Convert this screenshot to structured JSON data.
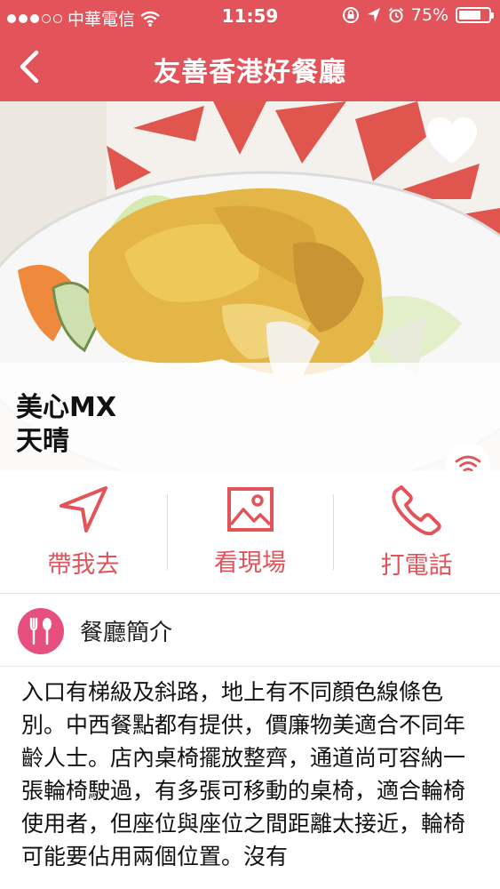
{
  "status_bar": {
    "carrier": "中華電信",
    "time": "11:59",
    "battery": "75%",
    "battery_level": 0.75
  },
  "nav": {
    "title": "友善香港好餐廳"
  },
  "restaurant": {
    "name_line1": "美心MX",
    "name_line2": "天晴"
  },
  "actions": [
    {
      "label": "帶我去",
      "icon": "navigation-arrow-icon"
    },
    {
      "label": "看現場",
      "icon": "image-icon"
    },
    {
      "label": "打電話",
      "icon": "phone-icon"
    }
  ],
  "intro": {
    "title": "餐廳簡介",
    "body": "入口有梯級及斜路，地上有不同顏色線條色別。中西餐點都有提供，價廉物美適合不同年齡人士。店內桌椅擺放整齊，通道尚可容納一張輪椅駛過，有多張可移動的桌椅，適合輪椅使用者，但座位與座位之間距離太接近，輪椅可能要佔用兩個位置。沒有"
  },
  "colors": {
    "accent": "#e2535a",
    "intro_icon_bg": "#e74f7f"
  }
}
